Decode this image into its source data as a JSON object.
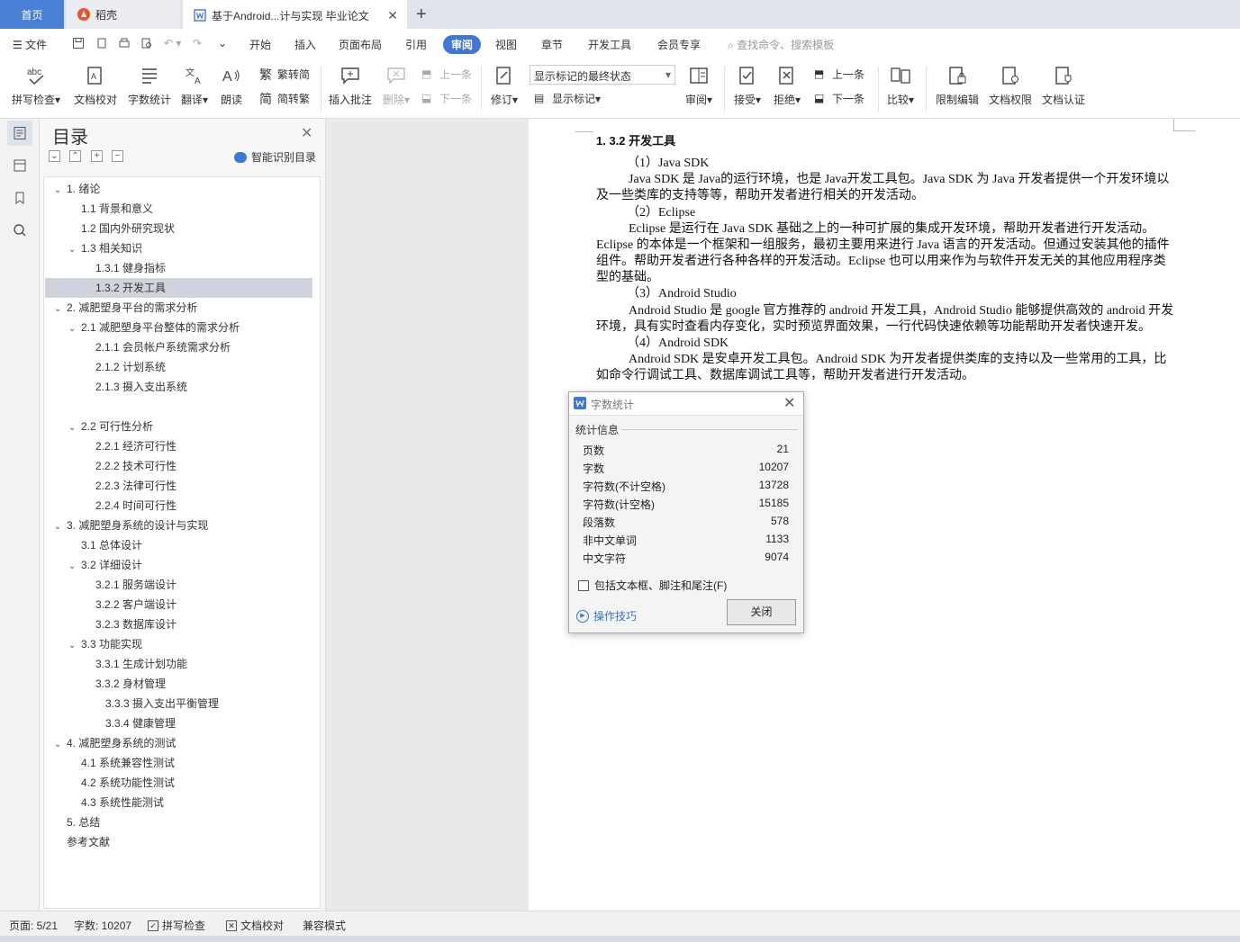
{
  "tabs": {
    "home": "首页",
    "daoke": "稻壳",
    "document": "基于Android...计与实现 毕业论文"
  },
  "menu": {
    "file": "文件",
    "items": [
      "开始",
      "插入",
      "页面布局",
      "引用",
      "审阅",
      "视图",
      "章节",
      "开发工具",
      "会员专享"
    ],
    "active": "审阅",
    "search_placeholder": "查找命令、搜索模板"
  },
  "ribbon": {
    "spellcheck": "拼写检查",
    "doc_proof": "文档校对",
    "word_count": "字数统计",
    "translate": "翻译",
    "read_aloud": "朗读",
    "trad_to_simp": "繁转简",
    "simp_to_trad": "简转繁",
    "insert_comment": "插入批注",
    "delete": "删除",
    "prev_comment": "上一条",
    "next_comment": "下一条",
    "revise": "修订",
    "markup_state": "显示标记的最终状态",
    "show_markup": "显示标记",
    "review": "审阅",
    "accept": "接受",
    "reject": "拒绝",
    "prev_change": "上一条",
    "next_change": "下一条",
    "compare": "比较",
    "restrict_edit": "限制编辑",
    "doc_permission": "文档权限",
    "doc_cert": "文档认证"
  },
  "toc": {
    "title": "目录",
    "smart": "智能识别目录",
    "items": [
      {
        "label": "1. 绪论",
        "arrow": "⌄"
      },
      {
        "label": "1.1 背景和意义",
        "arrow": ""
      },
      {
        "label": "1.2 国内外研究现状",
        "arrow": ""
      },
      {
        "label": "1.3 相关知识",
        "arrow": "⌄"
      },
      {
        "label": "1.3.1 健身指标",
        "arrow": ""
      },
      {
        "label": "1.3.2 开发工具",
        "arrow": ""
      },
      {
        "label": "2. 减肥塑身平台的需求分析",
        "arrow": "⌄"
      },
      {
        "label": "2.1 减肥塑身平台整体的需求分析",
        "arrow": "⌄"
      },
      {
        "label": "2.1.1 会员帐户系统需求分析",
        "arrow": ""
      },
      {
        "label": "2.1.2 计划系统",
        "arrow": ""
      },
      {
        "label": "2.1.3 摄入支出系统",
        "arrow": ""
      },
      {
        "label": "2.2 可行性分析",
        "arrow": "⌄"
      },
      {
        "label": "2.2.1 经济可行性",
        "arrow": ""
      },
      {
        "label": "2.2.2 技术可行性",
        "arrow": ""
      },
      {
        "label": "2.2.3 法律可行性",
        "arrow": ""
      },
      {
        "label": "2.2.4 时间可行性",
        "arrow": ""
      },
      {
        "label": "3. 减肥塑身系统的设计与实现",
        "arrow": "⌄"
      },
      {
        "label": "3.1 总体设计",
        "arrow": ""
      },
      {
        "label": "3.2 详细设计",
        "arrow": "⌄"
      },
      {
        "label": "3.2.1 服务端设计",
        "arrow": ""
      },
      {
        "label": "3.2.2 客户端设计",
        "arrow": ""
      },
      {
        "label": "3.2.3 数据库设计",
        "arrow": ""
      },
      {
        "label": "3.3 功能实现",
        "arrow": "⌄"
      },
      {
        "label": "3.3.1 生成计划功能",
        "arrow": ""
      },
      {
        "label": "3.3.2 身材管理",
        "arrow": ""
      },
      {
        "label": "3.3.3 摄入支出平衡管理",
        "arrow": ""
      },
      {
        "label": "3.3.4 健康管理",
        "arrow": ""
      },
      {
        "label": "4. 减肥塑身系统的测试",
        "arrow": "⌄"
      },
      {
        "label": "4.1 系统兼容性测试",
        "arrow": ""
      },
      {
        "label": "4.2 系统功能性测试",
        "arrow": ""
      },
      {
        "label": "4.3 系统性能测试",
        "arrow": ""
      },
      {
        "label": "5. 总结",
        "arrow": ""
      },
      {
        "label": "参考文献",
        "arrow": ""
      }
    ]
  },
  "document": {
    "heading": "1. 3.2 开发工具",
    "p1_title": "（1）Java SDK",
    "p1_body": "Java SDK 是 Java的运行环境，也是 Java开发工具包。Java SDK 为 Java 开发者提供一个开发环境以及一些类库的支持等等，帮助开发者进行相关的开发活动。",
    "p2_title": "（2）Eclipse",
    "p2_body": "Eclipse 是运行在 Java SDK 基础之上的一种可扩展的集成开发环境，帮助开发者进行开发活动。Eclipse 的本体是一个框架和一组服务，最初主要用来进行 Java 语言的开发活动。但通过安装其他的插件组件。帮助开发者进行各种各样的开发活动。Eclipse 也可以用来作为与软件开发无关的其他应用程序类型的基础。",
    "p3_title": "（3）Android Studio",
    "p3_body": "Android Studio 是 google 官方推荐的 android 开发工具，Android Studio 能够提供高效的 android 开发环境，具有实时查看内存变化，实时预览界面效果，一行代码快速依赖等功能帮助开发者快速开发。",
    "p4_title": "（4）Android SDK",
    "p4_body": "Android SDK 是安卓开发工具包。Android SDK 为开发者提供类库的支持以及一些常用的工具，比如命令行调试工具、数据库调试工具等，帮助开发者进行开发活动。"
  },
  "dialog": {
    "title": "字数统计",
    "section": "统计信息",
    "stats": [
      {
        "label": "页数",
        "value": "21"
      },
      {
        "label": "字数",
        "value": "10207"
      },
      {
        "label": "字符数(不计空格)",
        "value": "13728"
      },
      {
        "label": "字符数(计空格)",
        "value": "15185"
      },
      {
        "label": "段落数",
        "value": "578"
      },
      {
        "label": "非中文单词",
        "value": "1133"
      },
      {
        "label": "中文字符",
        "value": "9074"
      }
    ],
    "include_label": "包括文本框、脚注和尾注(F)",
    "tips": "操作技巧",
    "close": "关闭"
  },
  "status": {
    "page": "页面: 5/21",
    "words": "字数: 10207",
    "spell": "拼写检查",
    "proof": "文档校对",
    "compat": "兼容模式"
  },
  "colors": {
    "accent": "#3f76d8",
    "home_tab": "#4a7fd6",
    "link": "#3a73c8"
  }
}
